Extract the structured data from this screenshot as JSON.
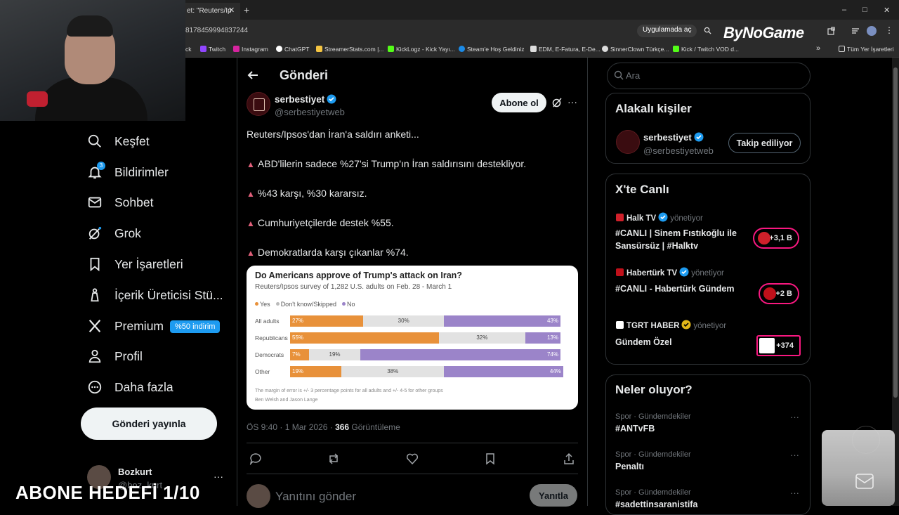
{
  "browser": {
    "tab_title": "et: \"Reuters/Ip",
    "tab_close": "✕",
    "new_tab": "+",
    "url": "8178459994837244",
    "open_in_app": "Uygulamada aç",
    "win_min": "–",
    "win_max": "□",
    "win_close": "✕",
    "brand": "ByNoGame",
    "bookmarks": [
      {
        "label": "ck",
        "color": "#555555"
      },
      {
        "label": "Twitch",
        "color": "#9146ff"
      },
      {
        "label": "Instagram",
        "color": "#d6249f"
      },
      {
        "label": "ChatGPT",
        "color": "#ffffff"
      },
      {
        "label": "StreamerStats.com |...",
        "color": "#f5c542"
      },
      {
        "label": "KickLogz - Kick Yayı...",
        "color": "#53fc18"
      },
      {
        "label": "Steam'e Hoş Geldiniz",
        "color": "#1b8ae6"
      },
      {
        "label": "EDM, E-Fatura, E-De...",
        "color": "#dddddd"
      },
      {
        "label": "SinnerClown Türkçe...",
        "color": "#dddddd"
      },
      {
        "label": "Kick / Twitch VOD d...",
        "color": "#53fc18"
      }
    ],
    "bookmarks_more": "»",
    "all_bookmarks": "Tüm Yer İşaretleri"
  },
  "nav": {
    "items": [
      {
        "label": "Keşfet"
      },
      {
        "label": "Bildirimler"
      },
      {
        "label": "Sohbet"
      },
      {
        "label": "Grok"
      },
      {
        "label": "Yer İşaretleri"
      },
      {
        "label": "İçerik Üreticisi Stü..."
      },
      {
        "label": "Premium"
      },
      {
        "label": "Profil"
      },
      {
        "label": "Daha fazla"
      }
    ],
    "notif_count": "3",
    "premium_badge": "%50 indirim",
    "post_button": "Gönderi yayınla",
    "account_name": "Bozkurt",
    "account_handle": "@boz_kurt",
    "account_more": "···"
  },
  "overlay": {
    "text": "ABONE HEDEFİ 1/10"
  },
  "post": {
    "header": "Gönderi",
    "author_name": "serbestiyet",
    "author_handle": "@serbestiyetweb",
    "subscribe": "Abone ol",
    "more": "···",
    "lines": [
      "Reuters/Ipsos'dan İran'a saldırı anketi...",
      "ABD'lilerin sadece %27'si Trump'ın İran saldırısını destekliyor.",
      "%43 karşı, %30 kararsız.",
      "Cumhuriyetçilerde destek %55.",
      "Demokratlarda karşı çıkanlar %74."
    ],
    "bullet": "▲",
    "meta_time": "ÖS 9:40 · 1 Mar 2026 · ",
    "meta_views": "366",
    "meta_views_label": " Görüntüleme",
    "reply_placeholder": "Yanıtını gönder",
    "reply_button": "Yanıtla"
  },
  "chart_data": {
    "type": "bar",
    "title": "Do Americans approve of Trump's attack on Iran?",
    "subtitle": "Reuters/Ipsos survey of 1,282 U.S. adults on Feb. 28 - March 1",
    "legend": [
      "Yes",
      "Don't know/Skipped",
      "No"
    ],
    "colors": [
      "#e8913a",
      "#e2e2e2",
      "#9b84c9"
    ],
    "categories": [
      "All adults",
      "Republicans",
      "Democrats",
      "Other"
    ],
    "series": [
      {
        "name": "Yes",
        "values": [
          27,
          55,
          7,
          19
        ]
      },
      {
        "name": "Don't know/Skipped",
        "values": [
          30,
          32,
          19,
          38
        ]
      },
      {
        "name": "No",
        "values": [
          43,
          13,
          74,
          44
        ]
      }
    ],
    "note": "The margin of error is +/- 3 percentage points for all adults and +/- 4-5 for other groups",
    "byline": "Ben Welsh and Jason Lange"
  },
  "sidebar": {
    "search_placeholder": "Ara",
    "related_title": "Alakalı kişiler",
    "related_name": "serbestiyet",
    "related_handle": "@serbestiyetweb",
    "follow_label": "Takip ediliyor",
    "live_title": "X'te Canlı",
    "live": [
      {
        "source": "Halk TV",
        "host": "yönetiyor",
        "title1": "#CANLI | Sinem Fıstıkoğlu ile",
        "title2": "Sansürsüz | #Halktv",
        "count": "+3,1 B",
        "color": "#d0202a"
      },
      {
        "source": "Habertürk TV",
        "host": "yönetiyor",
        "title1": "#CANLI - Habertürk Gündem",
        "title2": "",
        "count": "+2 B",
        "color": "#c0101a"
      },
      {
        "source": "TGRT HABER",
        "host": "yönetiyor",
        "title1": "Gündem Özel",
        "title2": "",
        "count": "+374",
        "color": "#ffffff"
      }
    ],
    "trends_title": "Neler oluyor?",
    "trends": [
      {
        "category": "Spor · Gündemdekiler",
        "name": "#ANTvFB"
      },
      {
        "category": "Spor · Gündemdekiler",
        "name": "Penaltı"
      },
      {
        "category": "Spor · Gündemdekiler",
        "name": "#sadettinsaranistifa"
      }
    ],
    "trend_more": "···"
  }
}
